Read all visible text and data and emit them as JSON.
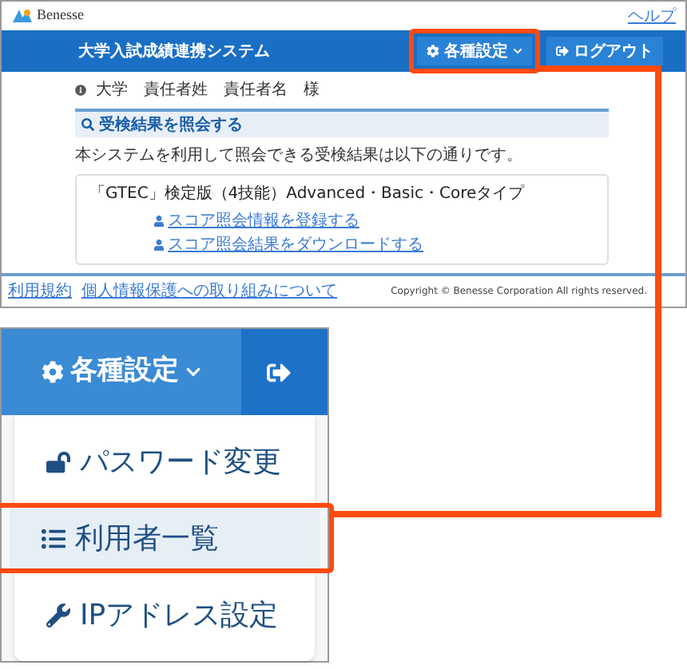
{
  "top_screen": {
    "logo": "Benesse",
    "help_link": "ヘルプ",
    "title": "大学入試成績連携システム",
    "nav": [
      {
        "label": "各種設定",
        "kind": "settings",
        "highlighted": true
      },
      {
        "label": "ログアウト",
        "kind": "logout",
        "highlighted": false
      }
    ],
    "user_line": "大学　責任者姓　責任者名　様",
    "section_title": "受検結果を照会する",
    "intro": "本システムを利用して照会できる受検結果は以下の通りです。",
    "exam": {
      "name": "「GTEC」検定版（4技能）Advanced・Basic・Coreタイプ",
      "links": [
        "スコア照会情報を登録する",
        "スコア照会結果をダウンロードする"
      ]
    },
    "footer_links": [
      "利用規約",
      "個人情報保護への取り組みについて"
    ],
    "copyright": "Copyright © Benesse Corporation All rights reserved."
  },
  "zoomed_menu": {
    "menu_button": "各種設定",
    "items": [
      {
        "label": "パスワード変更",
        "kind": "lock",
        "selected": false
      },
      {
        "label": "利用者一覧",
        "kind": "list",
        "selected": true
      },
      {
        "label": "IPアドレス設定",
        "kind": "wrench",
        "selected": false
      }
    ]
  }
}
